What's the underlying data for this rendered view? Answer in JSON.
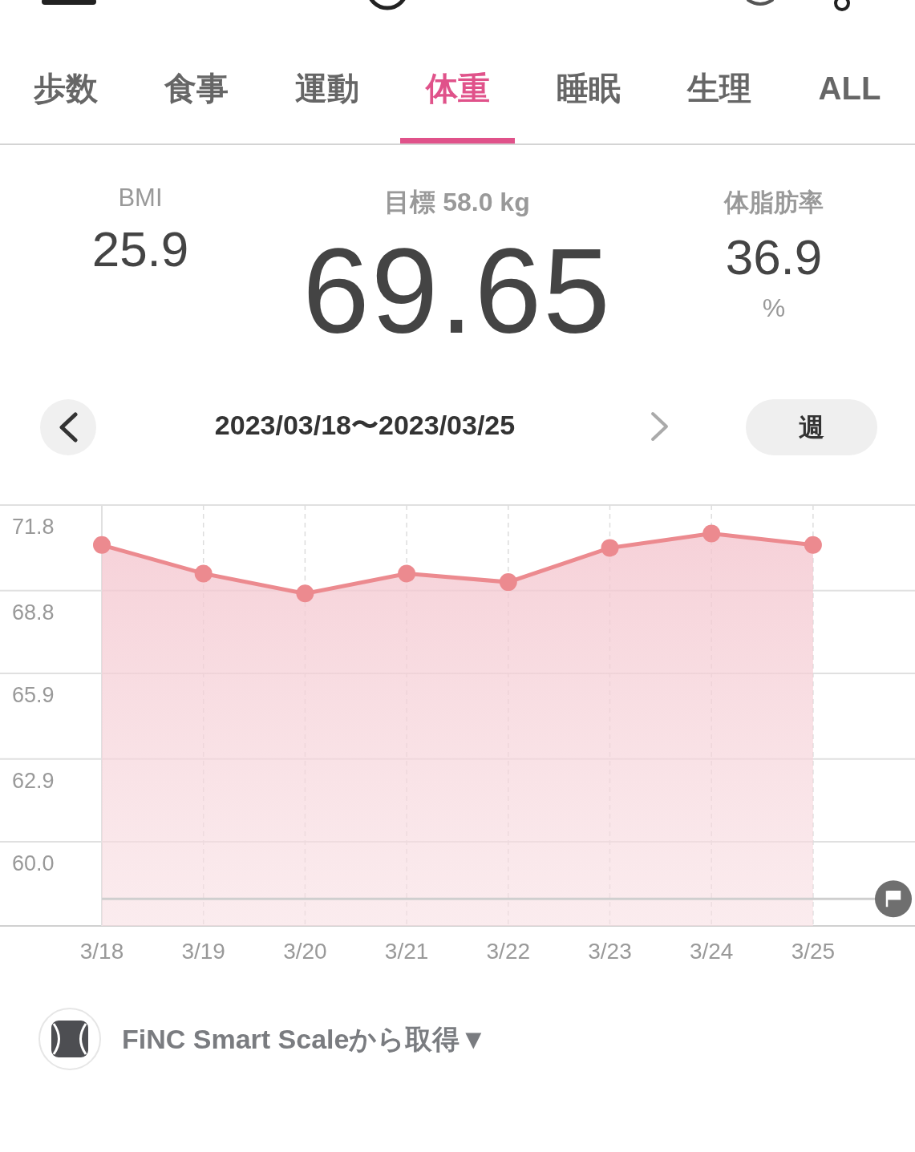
{
  "tabs": [
    {
      "label": "歩数",
      "selected": false
    },
    {
      "label": "食事",
      "selected": false
    },
    {
      "label": "運動",
      "selected": false
    },
    {
      "label": "体重",
      "selected": true
    },
    {
      "label": "睡眠",
      "selected": false
    },
    {
      "label": "生理",
      "selected": false
    },
    {
      "label": "ALL",
      "selected": false
    }
  ],
  "stats": {
    "bmi": {
      "label": "BMI",
      "value": "25.9"
    },
    "goal": "目標 58.0 kg",
    "weight": "69.65",
    "body_fat": {
      "label": "体脂肪率",
      "value": "36.9",
      "unit": "%"
    }
  },
  "date_range": "2023/03/18〜2023/03/25",
  "period_button": "週",
  "chart_data": {
    "type": "area",
    "categories": [
      "3/18",
      "3/19",
      "3/20",
      "3/21",
      "3/22",
      "3/23",
      "3/24",
      "3/25"
    ],
    "series": [
      {
        "color": "#ec8a8f",
        "values": [
          70.4,
          69.4,
          68.7,
          69.4,
          69.1,
          70.3,
          70.8,
          70.4
        ]
      }
    ],
    "ylim": [
      57.05,
      71.8
    ],
    "yticks": [
      {
        "value": 71.8,
        "label": "71.8"
      },
      {
        "value": 68.8,
        "label": "68.8"
      },
      {
        "value": 65.9,
        "label": "65.9"
      },
      {
        "value": 62.9,
        "label": "62.9"
      },
      {
        "value": 60,
        "label": "60.0"
      }
    ],
    "grid": true,
    "ref_lines": [
      {
        "axis": "y",
        "value": 58
      }
    ]
  },
  "source": "FiNC Smart Scaleから取得▼"
}
